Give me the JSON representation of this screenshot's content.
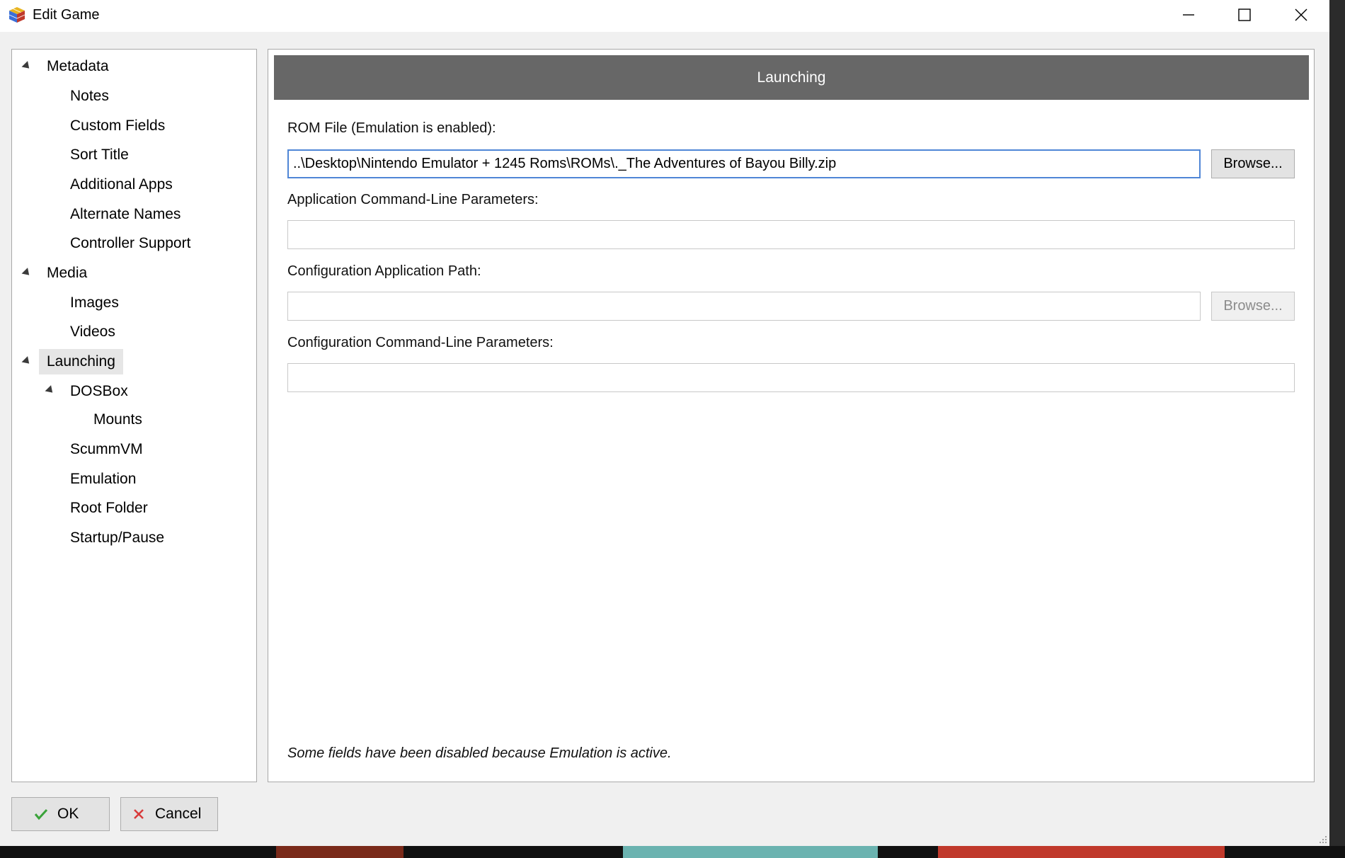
{
  "window": {
    "title": "Edit Game"
  },
  "tree": {
    "items": [
      {
        "label": "Metadata",
        "expanded": true,
        "level": 0
      },
      {
        "label": "Notes",
        "level": 1
      },
      {
        "label": "Custom Fields",
        "level": 1
      },
      {
        "label": "Sort Title",
        "level": 1
      },
      {
        "label": "Additional Apps",
        "level": 1
      },
      {
        "label": "Alternate Names",
        "level": 1
      },
      {
        "label": "Controller Support",
        "level": 1
      },
      {
        "label": "Media",
        "expanded": true,
        "level": 0
      },
      {
        "label": "Images",
        "level": 1
      },
      {
        "label": "Videos",
        "level": 1
      },
      {
        "label": "Launching",
        "expanded": true,
        "level": 0,
        "selected": true
      },
      {
        "label": "DOSBox",
        "expanded": true,
        "level": 1
      },
      {
        "label": "Mounts",
        "level": 2
      },
      {
        "label": "ScummVM",
        "level": 1
      },
      {
        "label": "Emulation",
        "level": 1
      },
      {
        "label": "Root Folder",
        "level": 1
      },
      {
        "label": "Startup/Pause",
        "level": 1
      }
    ]
  },
  "content": {
    "header": "Launching",
    "rom_file": {
      "label": "ROM File (Emulation is enabled):",
      "value": "..\\Desktop\\Nintendo Emulator + 1245 Roms\\ROMs\\._The Adventures of Bayou Billy.zip",
      "browse_label": "Browse..."
    },
    "app_params": {
      "label": "Application Command-Line Parameters:",
      "value": ""
    },
    "config_path": {
      "label": "Configuration Application Path:",
      "value": "",
      "browse_label": "Browse..."
    },
    "config_params": {
      "label": "Configuration Command-Line Parameters:",
      "value": ""
    },
    "notice": "Some fields have been disabled because Emulation is active."
  },
  "buttons": {
    "ok_label": "OK",
    "cancel_label": "Cancel"
  },
  "colors": {
    "header_bg": "#676767",
    "focus_border": "#4f86d6",
    "ok_check": "#3aa33a",
    "cancel_x": "#d83b3b"
  }
}
